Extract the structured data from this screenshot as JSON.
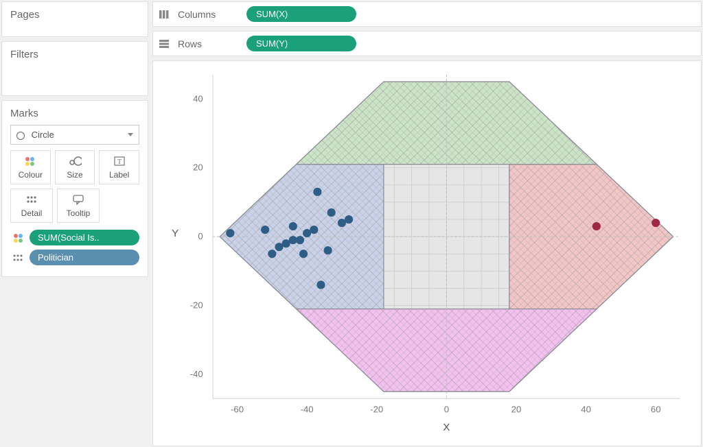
{
  "sidebar": {
    "pages_title": "Pages",
    "filters_title": "Filters",
    "marks_title": "Marks",
    "mark_type": "Circle",
    "cells": {
      "colour": "Colour",
      "size": "Size",
      "label": "Label",
      "detail": "Detail",
      "tooltip": "Tooltip"
    },
    "pills": [
      {
        "icon": "colour",
        "label": "SUM(Social Is..",
        "kind": "green"
      },
      {
        "icon": "detail",
        "label": "Politician",
        "kind": "blue"
      }
    ]
  },
  "shelves": {
    "columns_label": "Columns",
    "columns_pill": "SUM(X)",
    "rows_label": "Rows",
    "rows_pill": "SUM(Y)"
  },
  "chart_data": {
    "type": "scatter",
    "xlabel": "X",
    "ylabel": "Y",
    "xlim": [
      -67,
      67
    ],
    "ylim": [
      -47,
      47
    ],
    "xticks": [
      -60,
      -40,
      -20,
      0,
      20,
      40,
      60
    ],
    "yticks": [
      -40,
      -20,
      0,
      20,
      40
    ],
    "background_regions": [
      {
        "name": "top",
        "color": "#c7e0c3",
        "poly": [
          [
            -18,
            47
          ],
          [
            18,
            47
          ],
          [
            68,
            21
          ],
          [
            18,
            21
          ],
          [
            -18,
            21
          ],
          [
            -68,
            21
          ]
        ],
        "clip_hex": true,
        "sub": "top"
      },
      {
        "name": "right",
        "color": "#f1c3c3",
        "poly": [
          [
            18,
            21
          ],
          [
            68,
            21
          ],
          [
            68,
            -21
          ],
          [
            18,
            -21
          ]
        ]
      },
      {
        "name": "bottom",
        "color": "#f2beec",
        "poly": [
          [
            -18,
            -21
          ],
          [
            18,
            -21
          ],
          [
            68,
            -47
          ],
          [
            -68,
            -47
          ]
        ],
        "sub": "bottom"
      },
      {
        "name": "left",
        "color": "#c7cfe4",
        "poly": [
          [
            -68,
            21
          ],
          [
            -18,
            21
          ],
          [
            -18,
            -21
          ],
          [
            -68,
            -21
          ]
        ]
      },
      {
        "name": "center",
        "color": "#e4e4e4",
        "poly": [
          [
            -18,
            21
          ],
          [
            18,
            21
          ],
          [
            18,
            -21
          ],
          [
            -18,
            -21
          ]
        ]
      }
    ],
    "series": [
      {
        "name": "left-cluster",
        "color": "#2e5d86",
        "points": [
          [
            -62,
            1
          ],
          [
            -52,
            2
          ],
          [
            -50,
            -5
          ],
          [
            -48,
            -3
          ],
          [
            -46,
            -2
          ],
          [
            -44,
            -1
          ],
          [
            -44,
            3
          ],
          [
            -42,
            -1
          ],
          [
            -41,
            -5
          ],
          [
            -40,
            1
          ],
          [
            -38,
            2
          ],
          [
            -37,
            13
          ],
          [
            -36,
            -14
          ],
          [
            -34,
            -4
          ],
          [
            -33,
            7
          ],
          [
            -30,
            4
          ],
          [
            -28,
            5
          ]
        ]
      },
      {
        "name": "right-cluster",
        "color": "#a02846",
        "points": [
          [
            43,
            3
          ],
          [
            60,
            4
          ]
        ]
      }
    ]
  }
}
